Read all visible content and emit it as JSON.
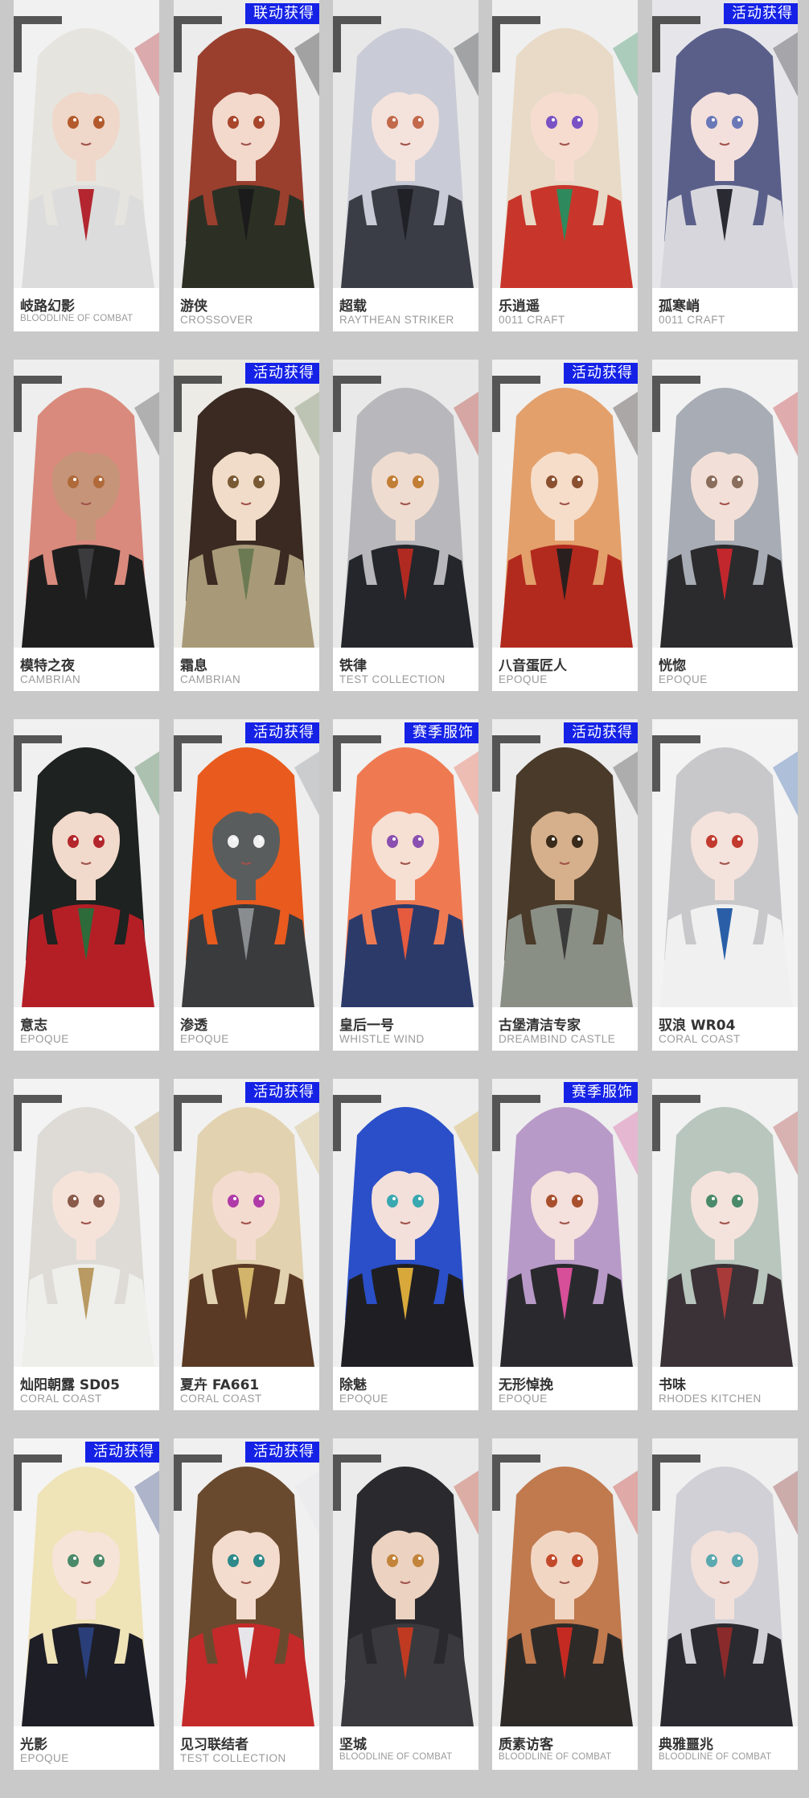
{
  "badge_color": "#1522e6",
  "background_color": "#c9c9c9",
  "cards": [
    {
      "name": "岐路幻影",
      "series": "BLOODLINE OF COMBAT",
      "badge": "",
      "hair": "#e6e4df",
      "skin": "#efd7c9",
      "outfit": "#dcdcdc",
      "accent": "#b3262f",
      "bg": "#f1f1f1",
      "eyes": "#b35a2c",
      "icon": "winged-operator-portrait-icon"
    },
    {
      "name": "游侠",
      "series": "CROSSOVER",
      "badge": "联动获得",
      "hair": "#9a3f2e",
      "skin": "#f2d9cc",
      "outfit": "#2c3024",
      "accent": "#1b1b1b",
      "bg": "#ececec",
      "eyes": "#a8462c",
      "icon": "cat-ear-cap-operator-icon"
    },
    {
      "name": "超载",
      "series": "RAYTHEAN STRIKER",
      "badge": "",
      "hair": "#c9ccd6",
      "skin": "#f4e2dc",
      "outfit": "#3a3d45",
      "accent": "#1f2126",
      "bg": "#e8e8e8",
      "eyes": "#c26a4b",
      "icon": "horned-operator-portrait-icon"
    },
    {
      "name": "乐逍遥",
      "series": "0011 CRAFT",
      "badge": "",
      "hair": "#e8dac6",
      "skin": "#f5dccf",
      "outfit": "#c8362b",
      "accent": "#2e8a5c",
      "bg": "#efefef",
      "eyes": "#7a52c4",
      "icon": "flute-operator-portrait-icon"
    },
    {
      "name": "孤寒峭",
      "series": "0011 CRAFT",
      "badge": "活动获得",
      "hair": "#5a5f8a",
      "skin": "#f3e0dc",
      "outfit": "#d6d6dc",
      "accent": "#2a2a33",
      "bg": "#e6e6ea",
      "eyes": "#6a78b8",
      "icon": "umbrella-operator-portrait-icon"
    },
    {
      "name": "模特之夜",
      "series": "CAMBRIAN",
      "badge": "",
      "hair": "#d98a7c",
      "skin": "#c69479",
      "outfit": "#1e1e1f",
      "accent": "#3b3b3d",
      "bg": "#eeeeee",
      "eyes": "#b06a3a",
      "icon": "beret-operator-portrait-icon"
    },
    {
      "name": "霜息",
      "series": "CAMBRIAN",
      "badge": "活动获得",
      "hair": "#3a2a22",
      "skin": "#f0dcc8",
      "outfit": "#a89a78",
      "accent": "#6b7a52",
      "bg": "#ecebe6",
      "eyes": "#7a5a34",
      "icon": "antler-operator-portrait-icon"
    },
    {
      "name": "铁律",
      "series": "TEST COLLECTION",
      "badge": "",
      "hair": "#b8b8bc",
      "skin": "#efdcd0",
      "outfit": "#24262b",
      "accent": "#b12a22",
      "bg": "#e9e9e9",
      "eyes": "#c27e35",
      "icon": "officer-cap-operator-icon"
    },
    {
      "name": "八音蛋匠人",
      "series": "EPOQUE",
      "badge": "活动获得",
      "hair": "#e3a06b",
      "skin": "#f6ddc9",
      "outfit": "#b22a1e",
      "accent": "#2a1f1f",
      "bg": "#f0f0f0",
      "eyes": "#8a5030",
      "icon": "fez-hat-operator-icon"
    },
    {
      "name": "恍惚",
      "series": "EPOQUE",
      "badge": "",
      "hair": "#a8acb4",
      "skin": "#f2e0d8",
      "outfit": "#2b2b2d",
      "accent": "#c1272d",
      "bg": "#f2f2f2",
      "eyes": "#8a6d5a",
      "icon": "headphone-operator-portrait-icon"
    },
    {
      "name": "意志",
      "series": "EPOQUE",
      "badge": "",
      "hair": "#1e2220",
      "skin": "#f1d9cb",
      "outfit": "#b41f26",
      "accent": "#2d6b3a",
      "bg": "#f0f0f0",
      "eyes": "#b3262b",
      "icon": "wolf-ear-operator-icon"
    },
    {
      "name": "渗透",
      "series": "EPOQUE",
      "badge": "活动获得",
      "hair": "#e85a1e",
      "skin": "#5a5d5e",
      "outfit": "#3a3b3d",
      "accent": "#8a8d90",
      "bg": "#eeeeee",
      "eyes": "#f0f0f0",
      "icon": "masked-operator-portrait-icon"
    },
    {
      "name": "皇后一号",
      "series": "WHISTLE WIND",
      "badge": "赛季服饰",
      "hair": "#ef7a52",
      "skin": "#f6dfd3",
      "outfit": "#2c3a6a",
      "accent": "#e65a3e",
      "bg": "#f1f1f1",
      "eyes": "#8a4fb0",
      "icon": "captain-hat-operator-icon"
    },
    {
      "name": "古堡清洁专家",
      "series": "DREAMBIND CASTLE",
      "badge": "活动获得",
      "hair": "#4a3a2a",
      "skin": "#d6b08c",
      "outfit": "#8a8f86",
      "accent": "#3a3a3a",
      "bg": "#ececec",
      "eyes": "#3a2a1a",
      "icon": "goggles-operator-portrait-icon"
    },
    {
      "name": "驭浪 WR04",
      "series": "CORAL COAST",
      "badge": "",
      "hair": "#c8c8ca",
      "skin": "#f4e2dc",
      "outfit": "#f0f0f0",
      "accent": "#2a5fa8",
      "bg": "#f3f3f3",
      "eyes": "#c23a2e",
      "icon": "swimsuit-operator-portrait-icon"
    },
    {
      "name": "灿阳朝露 SD05",
      "series": "CORAL COAST",
      "badge": "",
      "hair": "#dedbd6",
      "skin": "#f5e3da",
      "outfit": "#eeeeea",
      "accent": "#b89a62",
      "bg": "#f3f3f3",
      "eyes": "#8a5a4a",
      "icon": "laurel-crown-operator-icon"
    },
    {
      "name": "夏卉 FA661",
      "series": "CORAL COAST",
      "badge": "活动获得",
      "hair": "#e2d2b0",
      "skin": "#f3dccf",
      "outfit": "#5a3a24",
      "accent": "#d2b46a",
      "bg": "#f1f1f1",
      "eyes": "#b03aa8",
      "icon": "straw-hat-operator-icon"
    },
    {
      "name": "除魅",
      "series": "EPOQUE",
      "badge": "",
      "hair": "#2a4fc8",
      "skin": "#f3e0da",
      "outfit": "#1f1f23",
      "accent": "#d8a93a",
      "bg": "#efefef",
      "eyes": "#3aa8b0",
      "icon": "halo-operator-portrait-icon"
    },
    {
      "name": "无形悼挽",
      "series": "EPOQUE",
      "badge": "赛季服饰",
      "hair": "#b89ac8",
      "skin": "#f4e0dc",
      "outfit": "#2a2a2e",
      "accent": "#d64f98",
      "bg": "#eeeeee",
      "eyes": "#a8502e",
      "icon": "bat-wing-operator-icon"
    },
    {
      "name": "书味",
      "series": "RHODES KITCHEN",
      "badge": "",
      "hair": "#b8c6be",
      "skin": "#f4e3dc",
      "outfit": "#3a3236",
      "accent": "#a83a3a",
      "bg": "#f2f2f2",
      "eyes": "#4a8a6a",
      "icon": "bear-ear-book-operator-icon"
    },
    {
      "name": "光影",
      "series": "EPOQUE",
      "badge": "活动获得",
      "hair": "#efe3b8",
      "skin": "#f6e4d8",
      "outfit": "#1e1e26",
      "accent": "#2a3f7a",
      "bg": "#f4f4f4",
      "eyes": "#4a8a6a",
      "icon": "fox-ear-operator-icon"
    },
    {
      "name": "见习联结者",
      "series": "TEST COLLECTION",
      "badge": "活动获得",
      "hair": "#6a4a2e",
      "skin": "#f3dccd",
      "outfit": "#c42a2a",
      "accent": "#e6e6ea",
      "bg": "#f0f0f0",
      "eyes": "#2e8a8a",
      "icon": "scarf-operator-portrait-icon"
    },
    {
      "name": "坚城",
      "series": "BLOODLINE OF COMBAT",
      "badge": "",
      "hair": "#2a2a2e",
      "skin": "#ecd2c0",
      "outfit": "#3a3a3e",
      "accent": "#c03a22",
      "bg": "#ebebeb",
      "eyes": "#c2843a",
      "icon": "katana-operator-portrait-icon"
    },
    {
      "name": "质素访客",
      "series": "BLOODLINE OF COMBAT",
      "badge": "",
      "hair": "#c07a4e",
      "skin": "#f2d6c4",
      "outfit": "#2e2a28",
      "accent": "#c42a22",
      "bg": "#ededed",
      "eyes": "#c24a2a",
      "icon": "twin-tail-operator-icon"
    },
    {
      "name": "典雅噩兆",
      "series": "BLOODLINE OF COMBAT",
      "badge": "",
      "hair": "#d0d0d6",
      "skin": "#f2e0da",
      "outfit": "#2a2a30",
      "accent": "#8a2a2a",
      "bg": "#f0f0f0",
      "eyes": "#5aa8b0",
      "icon": "wolf-ear-silver-operator-icon"
    }
  ]
}
